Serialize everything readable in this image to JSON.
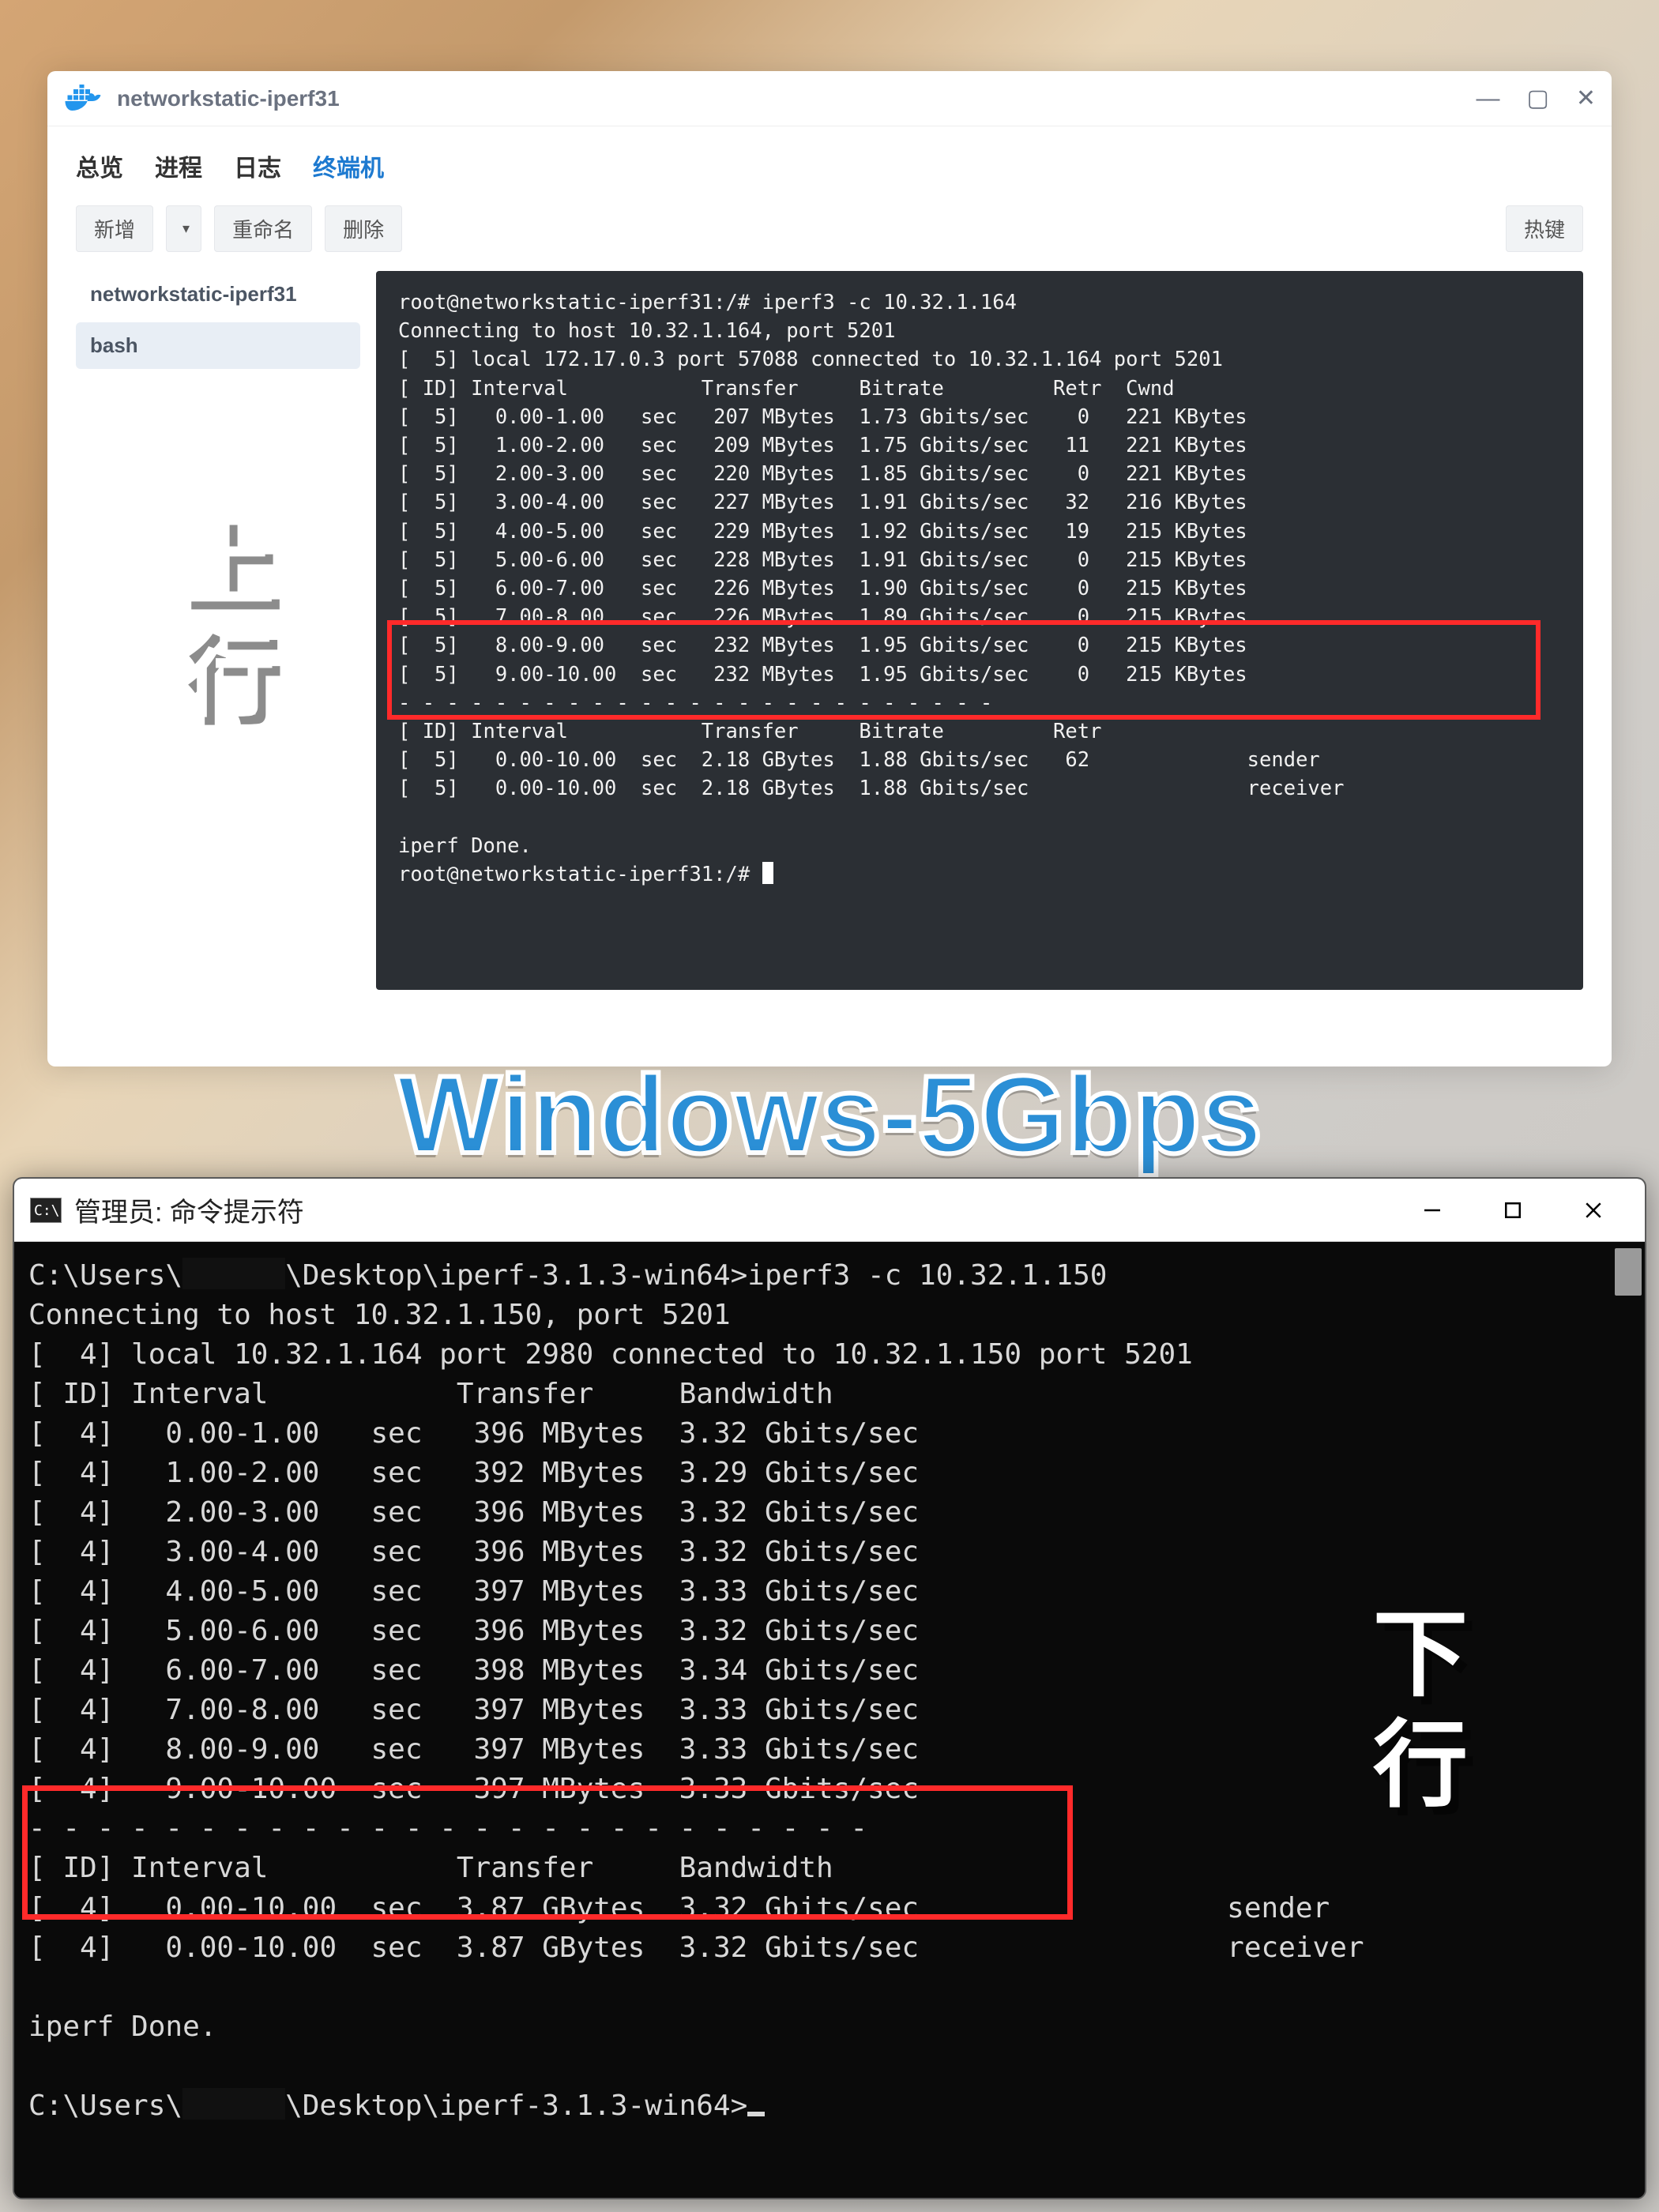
{
  "top_window": {
    "title": "networkstatic-iperf31",
    "tabs": [
      "总览",
      "进程",
      "日志",
      "终端机"
    ],
    "active_tab_index": 3,
    "toolbar": {
      "new": "新增",
      "rename": "重命名",
      "delete": "删除",
      "hotkey": "热键"
    },
    "sessions": [
      {
        "name": "networkstatic-iperf31",
        "active": false
      },
      {
        "name": "bash",
        "active": true
      }
    ],
    "terminal": {
      "prompt1": "root@networkstatic-iperf31:/# iperf3 -c 10.32.1.164",
      "line2": "Connecting to host 10.32.1.164, port 5201",
      "line3": "[  5] local 172.17.0.3 port 57088 connected to 10.32.1.164 port 5201",
      "header": "[ ID] Interval           Transfer     Bitrate         Retr  Cwnd",
      "rows": [
        "[  5]   0.00-1.00   sec   207 MBytes  1.73 Gbits/sec    0   221 KBytes",
        "[  5]   1.00-2.00   sec   209 MBytes  1.75 Gbits/sec   11   221 KBytes",
        "[  5]   2.00-3.00   sec   220 MBytes  1.85 Gbits/sec    0   221 KBytes",
        "[  5]   3.00-4.00   sec   227 MBytes  1.91 Gbits/sec   32   216 KBytes",
        "[  5]   4.00-5.00   sec   229 MBytes  1.92 Gbits/sec   19   215 KBytes",
        "[  5]   5.00-6.00   sec   228 MBytes  1.91 Gbits/sec    0   215 KBytes",
        "[  5]   6.00-7.00   sec   226 MBytes  1.90 Gbits/sec    0   215 KBytes",
        "[  5]   7.00-8.00   sec   226 MBytes  1.89 Gbits/sec    0   215 KBytes",
        "[  5]   8.00-9.00   sec   232 MBytes  1.95 Gbits/sec    0   215 KBytes",
        "[  5]   9.00-10.00  sec   232 MBytes  1.95 Gbits/sec    0   215 KBytes"
      ],
      "dashes": "- - - - - - - - - - - - - - - - - - - - - - - - -",
      "sum_header": "[ ID] Interval           Transfer     Bitrate         Retr",
      "sum_rows": [
        "[  5]   0.00-10.00  sec  2.18 GBytes  1.88 Gbits/sec   62             sender",
        "[  5]   0.00-10.00  sec  2.18 GBytes  1.88 Gbits/sec                  receiver"
      ],
      "done": "iperf Done.",
      "prompt2": "root@networkstatic-iperf31:/# "
    }
  },
  "labels": {
    "upstream": "上行",
    "downstream": "下行",
    "center": "Windows-5Gbps"
  },
  "bottom_window": {
    "title": "管理员: 命令提示符",
    "icon_text": "C:\\.",
    "cmd": {
      "line1a": "C:\\Users\\",
      "line1b": "\\Desktop\\iperf-3.1.3-win64>iperf3 -c 10.32.1.150",
      "line2": "Connecting to host 10.32.1.150, port 5201",
      "line3": "[  4] local 10.32.1.164 port 2980 connected to 10.32.1.150 port 5201",
      "header": "[ ID] Interval           Transfer     Bandwidth",
      "rows": [
        "[  4]   0.00-1.00   sec   396 MBytes  3.32 Gbits/sec",
        "[  4]   1.00-2.00   sec   392 MBytes  3.29 Gbits/sec",
        "[  4]   2.00-3.00   sec   396 MBytes  3.32 Gbits/sec",
        "[  4]   3.00-4.00   sec   396 MBytes  3.32 Gbits/sec",
        "[  4]   4.00-5.00   sec   397 MBytes  3.33 Gbits/sec",
        "[  4]   5.00-6.00   sec   396 MBytes  3.32 Gbits/sec",
        "[  4]   6.00-7.00   sec   398 MBytes  3.34 Gbits/sec",
        "[  4]   7.00-8.00   sec   397 MBytes  3.33 Gbits/sec",
        "[  4]   8.00-9.00   sec   397 MBytes  3.33 Gbits/sec",
        "[  4]   9.00-10.00  sec   397 MBytes  3.33 Gbits/sec"
      ],
      "dashes": "- - - - - - - - - - - - - - - - - - - - - - - - -",
      "sum_header": "[ ID] Interval           Transfer     Bandwidth",
      "sum_rows": [
        "[  4]   0.00-10.00  sec  3.87 GBytes  3.32 Gbits/sec                  sender",
        "[  4]   0.00-10.00  sec  3.87 GBytes  3.32 Gbits/sec                  receiver"
      ],
      "done": "iperf Done.",
      "prompt2a": "C:\\Users\\",
      "prompt2b": "\\Desktop\\iperf-3.1.3-win64>"
    }
  }
}
